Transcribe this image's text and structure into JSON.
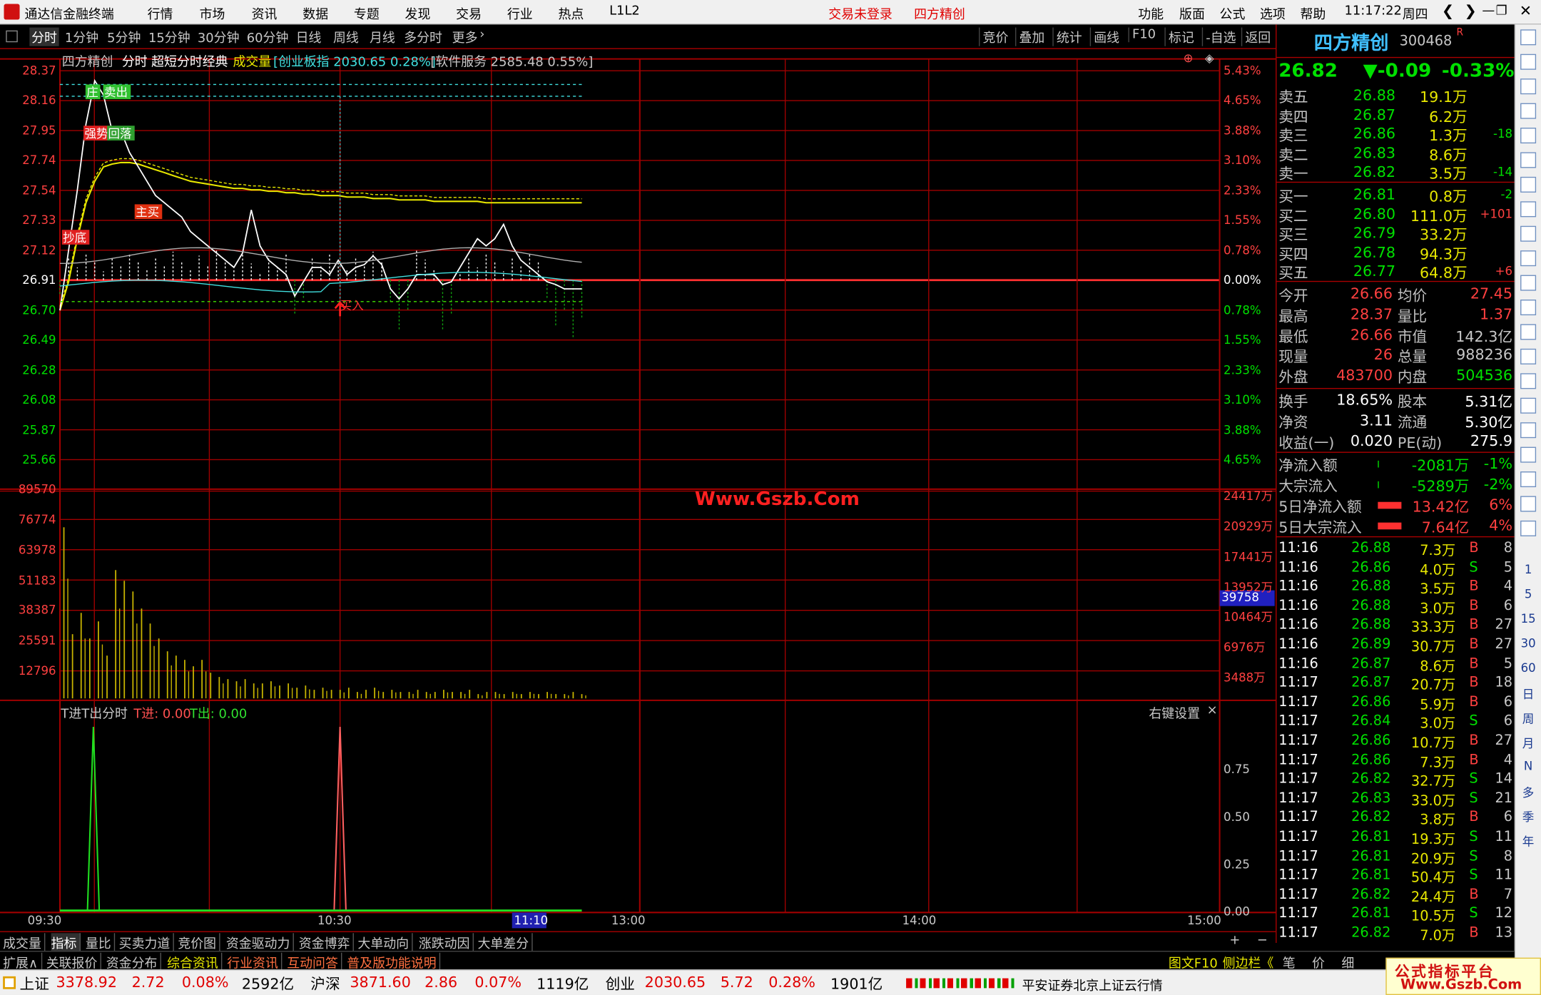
{
  "app": {
    "title": "通达信金融终端",
    "menu": [
      "行情",
      "市场",
      "资讯",
      "数据",
      "专题",
      "发现",
      "交易",
      "行业",
      "热点",
      "L1L2"
    ],
    "login": "交易未登录",
    "stock_tag": "四方精创",
    "right_menu": [
      "功能",
      "版面",
      "公式",
      "选项",
      "帮助"
    ],
    "time": "11:17:22",
    "weekday": "周四"
  },
  "toolbar": {
    "periods": [
      "分时",
      "1分钟",
      "5分钟",
      "15分钟",
      "30分钟",
      "60分钟",
      "日线",
      "周线",
      "月线",
      "多分时",
      "更多"
    ],
    "actions": [
      "竞价",
      "叠加",
      "统计",
      "画线",
      "F10",
      "标记",
      "-自选",
      "返回"
    ]
  },
  "chart_header": {
    "name": "四方精创",
    "mode": "分时",
    "formula": "超短分时经典",
    "vol_label": "成交量",
    "index_info": "[创业板指 2030.65 0.28%]",
    "sector_info": "[软件服务 2585.48 0.55%]"
  },
  "watermark_text": "Www.Gszb.Com",
  "chart_data": {
    "type": "line",
    "price_axis": [
      "28.37",
      "28.16",
      "27.95",
      "27.74",
      "27.54",
      "27.33",
      "27.12",
      "26.91",
      "26.70",
      "26.49",
      "26.28",
      "26.08",
      "25.87",
      "25.66"
    ],
    "pct_axis": [
      "5.43%",
      "4.65%",
      "3.88%",
      "3.10%",
      "2.33%",
      "1.55%",
      "0.78%",
      "0.00%",
      "0.78%",
      "1.55%",
      "2.33%",
      "3.10%",
      "3.88%",
      "4.65%"
    ],
    "prev_close": 26.91,
    "ylim": [
      25.66,
      28.37
    ],
    "price_series": [
      26.7,
      27.12,
      27.54,
      28.0,
      28.3,
      28.2,
      27.95,
      27.95,
      27.8,
      27.7,
      27.6,
      27.5,
      27.45,
      27.4,
      27.35,
      27.25,
      27.2,
      27.15,
      27.1,
      27.05,
      27.0,
      27.1,
      27.4,
      27.15,
      27.05,
      27.0,
      26.95,
      26.8,
      26.9,
      27.0,
      27.0,
      26.95,
      27.05,
      26.95,
      27.0,
      27.02,
      27.08,
      27.02,
      26.85,
      26.78,
      26.85,
      26.95,
      26.95,
      26.95,
      26.88,
      26.9,
      27.0,
      27.1,
      27.2,
      27.15,
      27.2,
      27.3,
      27.15,
      27.05,
      27.0,
      26.95,
      26.9,
      26.88,
      26.85,
      26.85,
      26.85
    ],
    "avg_series": [
      26.7,
      26.9,
      27.2,
      27.45,
      27.6,
      27.7,
      27.72,
      27.73,
      27.73,
      27.72,
      27.7,
      27.68,
      27.66,
      27.64,
      27.62,
      27.6,
      27.59,
      27.58,
      27.57,
      27.56,
      27.55,
      27.55,
      27.54,
      27.54,
      27.53,
      27.53,
      27.52,
      27.52,
      27.51,
      27.51,
      27.5,
      27.5,
      27.5,
      27.49,
      27.49,
      27.49,
      27.48,
      27.48,
      27.48,
      27.47,
      27.47,
      27.47,
      27.47,
      27.46,
      27.46,
      27.46,
      27.46,
      27.46,
      27.46,
      27.45,
      27.45,
      27.45,
      27.45,
      27.45,
      27.45,
      27.45,
      27.45,
      27.45,
      27.45,
      27.45,
      27.45
    ],
    "vol_axis": [
      "89570",
      "76774",
      "63978",
      "51183",
      "38387",
      "25591",
      "12796"
    ],
    "amt_axis": [
      "24417万",
      "20929万",
      "17441万",
      "13952万",
      "10464万",
      "6976万",
      "3488万"
    ],
    "vol_cursor": "39758",
    "volume": [
      80000,
      30000,
      40000,
      28000,
      36000,
      20000,
      60000,
      55000,
      50000,
      42000,
      35000,
      28000,
      22000,
      20000,
      18000,
      15000,
      18000,
      12000,
      10000,
      9000,
      8000,
      9000,
      7000,
      7000,
      8000,
      6000,
      7000,
      5000,
      6000,
      4000,
      5000,
      4000,
      4000,
      5000,
      3000,
      4000,
      5000,
      3000,
      4000,
      3000,
      3000,
      4000,
      3000,
      3000,
      4000,
      3000,
      3000,
      4000,
      2000,
      3000,
      3000,
      2000,
      3000,
      2000,
      3000,
      2000,
      3000,
      2000,
      2000,
      3000,
      2000
    ],
    "x_ticks": [
      "09:30",
      "10:30",
      "11:10",
      "13:00",
      "14:00",
      "15:00"
    ],
    "signals": [
      "庄",
      "卖出",
      "强势",
      "回落",
      "主买",
      "抄底",
      "买入"
    ],
    "t_indicator": {
      "title": "T进T出分时",
      "t_in_label": "T进: 0.00",
      "t_out_label": "T出: 0.00",
      "axis": [
        "0.75",
        "0.50",
        "0.25",
        "0.00"
      ],
      "settings": "右键设置"
    }
  },
  "quote": {
    "name": "四方精创",
    "code": "300468",
    "price": "26.82",
    "change": "▼-0.09",
    "pct": "-0.33%",
    "asks": [
      {
        "label": "卖五",
        "price": "26.88",
        "vol": "19.1万",
        "d": ""
      },
      {
        "label": "卖四",
        "price": "26.87",
        "vol": "6.2万",
        "d": ""
      },
      {
        "label": "卖三",
        "price": "26.86",
        "vol": "1.3万",
        "d": "-18"
      },
      {
        "label": "卖二",
        "price": "26.83",
        "vol": "8.6万",
        "d": ""
      },
      {
        "label": "卖一",
        "price": "26.82",
        "vol": "3.5万",
        "d": "-14"
      }
    ],
    "bids": [
      {
        "label": "买一",
        "price": "26.81",
        "vol": "0.8万",
        "d": "-2"
      },
      {
        "label": "买二",
        "price": "26.80",
        "vol": "111.0万",
        "d": "+101"
      },
      {
        "label": "买三",
        "price": "26.79",
        "vol": "33.2万",
        "d": ""
      },
      {
        "label": "买四",
        "price": "26.78",
        "vol": "94.3万",
        "d": ""
      },
      {
        "label": "买五",
        "price": "26.77",
        "vol": "64.8万",
        "d": "+6"
      }
    ],
    "stats": [
      [
        "今开",
        "26.66",
        "均价",
        "27.45"
      ],
      [
        "最高",
        "28.37",
        "量比",
        "1.37"
      ],
      [
        "最低",
        "26.66",
        "市值",
        "142.3亿"
      ],
      [
        "现量",
        "26",
        "总量",
        "988236"
      ],
      [
        "外盘",
        "483700",
        "内盘",
        "504536"
      ]
    ],
    "stats2": [
      [
        "换手",
        "18.65%",
        "股本",
        "5.31亿"
      ],
      [
        "净资",
        "3.11",
        "流通",
        "5.30亿"
      ],
      [
        "收益(一)",
        "0.020",
        "PE(动)",
        "275.9"
      ]
    ],
    "flows": [
      {
        "label": "净流入额",
        "val": "-2081万",
        "pct": "-1%"
      },
      {
        "label": "大宗流入",
        "val": "-5289万",
        "pct": "-2%"
      },
      {
        "label": "5日净流入额",
        "val": "13.42亿",
        "pct": "6%"
      },
      {
        "label": "5日大宗流入",
        "val": "7.64亿",
        "pct": "4%"
      }
    ],
    "ticks": [
      [
        "11:16",
        "26.88",
        "7.3万",
        "B",
        "8"
      ],
      [
        "11:16",
        "26.86",
        "4.0万",
        "S",
        "5"
      ],
      [
        "11:16",
        "26.88",
        "3.5万",
        "B",
        "4"
      ],
      [
        "11:16",
        "26.88",
        "3.0万",
        "B",
        "6"
      ],
      [
        "11:16",
        "26.88",
        "33.3万",
        "B",
        "27"
      ],
      [
        "11:16",
        "26.89",
        "30.7万",
        "B",
        "27"
      ],
      [
        "11:16",
        "26.87",
        "8.6万",
        "B",
        "5"
      ],
      [
        "11:17",
        "26.87",
        "20.7万",
        "B",
        "18"
      ],
      [
        "11:17",
        "26.86",
        "5.9万",
        "B",
        "6"
      ],
      [
        "11:17",
        "26.84",
        "3.0万",
        "S",
        "6"
      ],
      [
        "11:17",
        "26.86",
        "10.7万",
        "B",
        "27"
      ],
      [
        "11:17",
        "26.86",
        "7.3万",
        "B",
        "4"
      ],
      [
        "11:17",
        "26.82",
        "32.7万",
        "S",
        "14"
      ],
      [
        "11:17",
        "26.83",
        "33.0万",
        "S",
        "21"
      ],
      [
        "11:17",
        "26.82",
        "3.8万",
        "B",
        "6"
      ],
      [
        "11:17",
        "26.81",
        "19.3万",
        "S",
        "11"
      ],
      [
        "11:17",
        "26.81",
        "20.9万",
        "S",
        "8"
      ],
      [
        "11:17",
        "26.81",
        "50.4万",
        "S",
        "11"
      ],
      [
        "11:17",
        "26.82",
        "24.4万",
        "B",
        "7"
      ],
      [
        "11:17",
        "26.81",
        "10.5万",
        "S",
        "12"
      ],
      [
        "11:17",
        "26.82",
        "7.0万",
        "B",
        "13"
      ]
    ]
  },
  "sidebar": [
    "1",
    "5",
    "15",
    "30",
    "60",
    "日",
    "周",
    "月",
    "N",
    "多",
    "季",
    "年"
  ],
  "tabs1": [
    "成交量",
    "指标",
    "量比",
    "买卖力道",
    "竞价图",
    "资金驱动力",
    "资金博弈",
    "大单动向",
    "涨跌动因",
    "大单差分"
  ],
  "tabs2": [
    "扩展∧",
    "关联报价",
    "资金分布",
    "综合资讯",
    "行业资讯",
    "互动问答",
    "普及版功能说明"
  ],
  "tabs2_right": [
    "图文F10",
    "侧边栏《",
    "笔",
    "价",
    "细"
  ],
  "status": {
    "sh_name": "上证",
    "sh": "3378.92",
    "sh_chg": "2.72",
    "sh_pct": "0.08%",
    "sh_amt": "2592亿",
    "sz_name": "沪深",
    "sz": "3871.60",
    "sz_chg": "2.86",
    "sz_pct": "0.07%",
    "sz_amt": "1119亿",
    "cy_name": "创业",
    "cy": "2030.65",
    "cy_chg": "5.72",
    "cy_pct": "0.28%",
    "cy_amt": "1901亿",
    "server": "平安证券北京上证云行情"
  },
  "watermark": {
    "line1": "公式指标平台",
    "line2": "Www.Gszb.Com"
  },
  "colors": {
    "up": "#ff3c3c",
    "down": "#00e000",
    "price_line": "#ffffff",
    "avg_line": "#e8e800",
    "grid": "#a00000",
    "volume": "#c8b400",
    "cyan": "#40e0e0"
  }
}
